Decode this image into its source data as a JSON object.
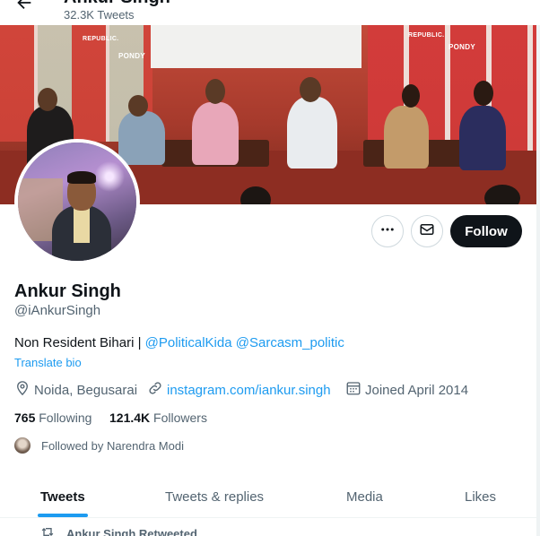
{
  "header": {
    "back_icon": "arrow-left-icon",
    "title": "Ankur Singh",
    "tweet_count": "32.3K Tweets"
  },
  "banner": {
    "sign_text": "REPUBLIC.",
    "fest_text": "PONDY"
  },
  "actions": {
    "more_icon": "more-dots-icon",
    "message_icon": "mail-icon",
    "follow_label": "Follow"
  },
  "profile": {
    "name": "Ankur Singh",
    "handle": "@iAnkurSingh",
    "bio_text": "Non Resident Bihari | ",
    "bio_mentions": "@PoliticalKida @Sarcasm_politic",
    "translate_label": "Translate bio",
    "location": "Noida, Begusarai",
    "website": "instagram.com/iankur.singh",
    "joined": "Joined April 2014"
  },
  "stats": {
    "following_count": "765",
    "following_label": "Following",
    "followers_count": "121.4K",
    "followers_label": "Followers"
  },
  "followed_by": "Followed by Narendra Modi",
  "tabs": [
    {
      "label": "Tweets",
      "active": true
    },
    {
      "label": "Tweets & replies",
      "active": false
    },
    {
      "label": "Media",
      "active": false
    },
    {
      "label": "Likes",
      "active": false
    }
  ],
  "feed": {
    "retweet_text": "Ankur Singh Retweeted"
  },
  "colors": {
    "accent": "#1d9bf0",
    "text": "#0f1419",
    "muted": "#536471"
  }
}
